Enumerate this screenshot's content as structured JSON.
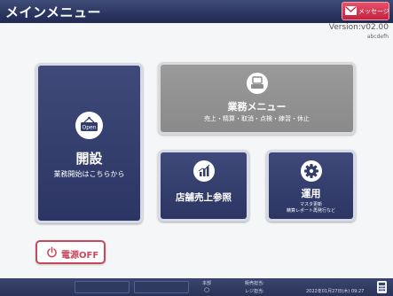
{
  "header": {
    "title": "メインメニュー"
  },
  "message_button": {
    "label": "メッセージ",
    "icon": "envelope-icon"
  },
  "version": {
    "text": "Version:v02.00",
    "sub": "abcdefh"
  },
  "tiles": {
    "kaisetsu": {
      "title": "開設",
      "subtitle": "業務開始はこちらから",
      "icon": "open-sign-icon",
      "sign_text": "Open"
    },
    "gyomu": {
      "title": "業務メニュー",
      "subtitle": "売上・精算・取消・点検・練習・休止",
      "icon": "register-icon"
    },
    "tenpo": {
      "title": "店舗売上参照",
      "icon": "bar-chart-icon"
    },
    "unyo": {
      "title": "運用",
      "line1": "マスタ更新",
      "line2": "精算レポート再発行など",
      "icon": "gear-icon"
    }
  },
  "power_button": {
    "label": "電源OFF",
    "icon": "power-icon"
  },
  "footer": {
    "shop_label": "本部",
    "status_indicator": "○",
    "sales_person_label": "販売担当:",
    "register_person_label": "レジ担当:",
    "datetime": "2022年01月27日(木) 09:27",
    "calculator_icon": "calculator-icon"
  },
  "colors": {
    "header": "#2b3560",
    "tile_dark": "#333d6c",
    "tile_gray": "#909090",
    "accent_red": "#c8485e",
    "message_red": "#d93a55"
  }
}
